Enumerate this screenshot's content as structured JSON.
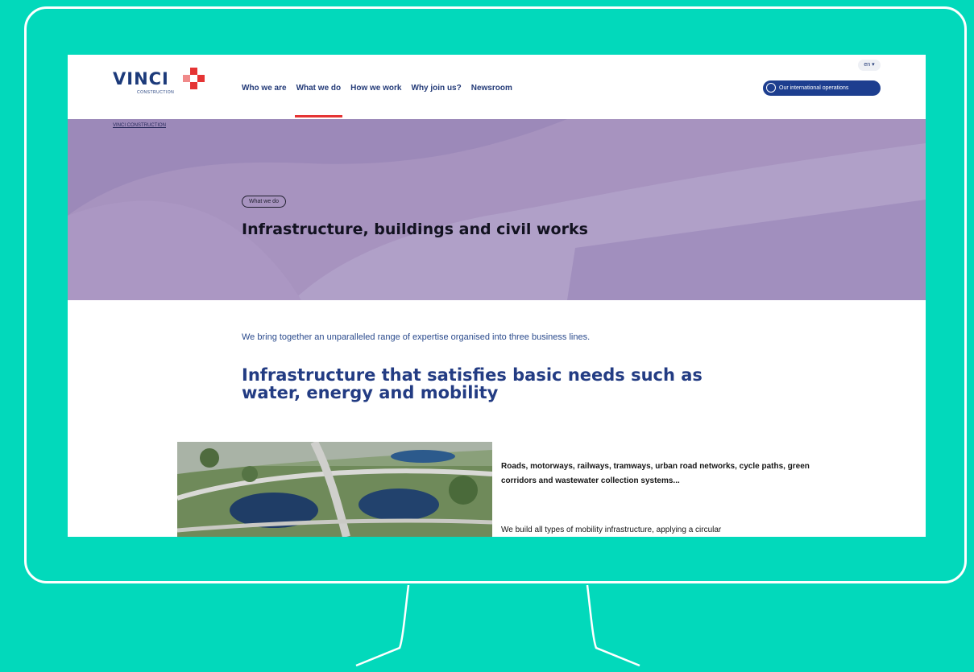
{
  "colors": {
    "background": "#02d9bb",
    "hero": "#a793bf",
    "navy": "#243b78",
    "accent": "#e53434"
  },
  "logo": {
    "word": "VINCI",
    "sub": "CONSTRUCTION"
  },
  "nav": {
    "items": [
      {
        "label": "Who we are"
      },
      {
        "label": "What we do"
      },
      {
        "label": "How we work"
      },
      {
        "label": "Why join us?"
      },
      {
        "label": "Newsroom"
      }
    ],
    "active_index": 1
  },
  "language": {
    "value": "en ▾"
  },
  "intl_button": {
    "label": "Our international operations",
    "icon": "globe-icon"
  },
  "breadcrumb": {
    "label": "VINCI CONSTRUCTION"
  },
  "hero": {
    "tag": "What we do",
    "title": "Infrastructure, buildings and civil works"
  },
  "intro": "We bring together an unparalleled range of expertise organised into three business lines.",
  "section": {
    "title": "Infrastructure that satisfies basic needs such as water, energy and mobility",
    "feature_bold": "Roads, motorways, railways, tramways, urban road networks, cycle paths, green corridors and wastewater collection systems...",
    "feature_text": "We build all types of mobility infrastructure, applying a circular"
  }
}
